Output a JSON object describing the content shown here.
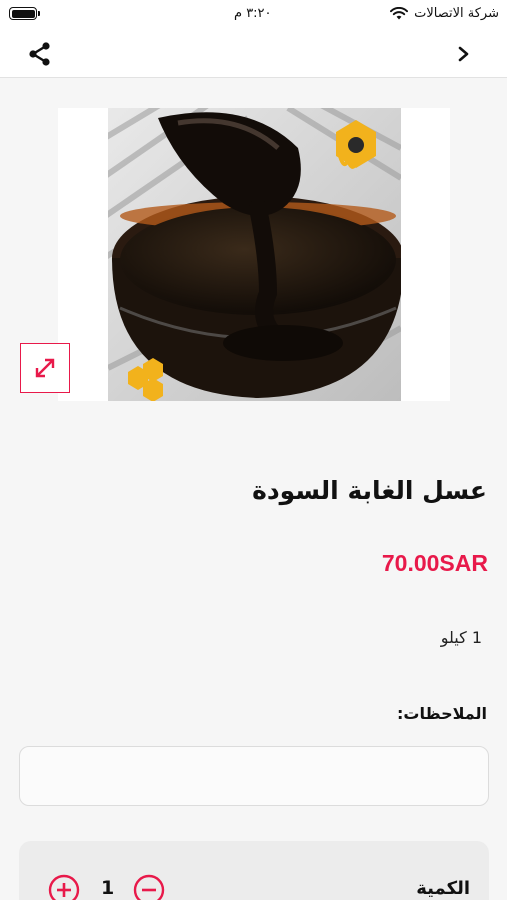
{
  "status_bar": {
    "carrier": "شركة الاتصالات",
    "time": "٣:٢٠ م"
  },
  "nav": {
    "share_icon": "share-icon",
    "back_icon": "chevron-right-icon"
  },
  "product": {
    "title": "عسل الغابة السودة",
    "price": "70.00SAR",
    "variant": "1 كيلو",
    "image_icon": "honey-product-photo",
    "expand_icon": "expand-icon"
  },
  "notes": {
    "label": "الملاحظات:",
    "value": "",
    "placeholder": ""
  },
  "quantity": {
    "label": "الكمية",
    "value": "1"
  },
  "colors": {
    "accent": "#e8194a",
    "background": "#f6f6f6"
  }
}
